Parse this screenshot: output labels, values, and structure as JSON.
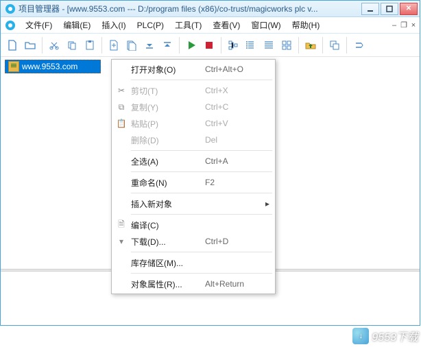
{
  "window": {
    "title": "项目管理器 - [www.9553.com --- D:/program files (x86)/co-trust/magicworks plc v..."
  },
  "menu": {
    "file": "文件(F)",
    "edit": "编辑(E)",
    "insert": "插入(I)",
    "plc": "PLC(P)",
    "tools": "工具(T)",
    "view": "查看(V)",
    "window": "窗口(W)",
    "help": "帮助(H)"
  },
  "tree": {
    "item0": "www.9553.com"
  },
  "ctx": {
    "open": {
      "label": "打开对象(O)",
      "shortcut": "Ctrl+Alt+O"
    },
    "cut": {
      "label": "剪切(T)",
      "shortcut": "Ctrl+X"
    },
    "copy": {
      "label": "复制(Y)",
      "shortcut": "Ctrl+C"
    },
    "paste": {
      "label": "粘贴(P)",
      "shortcut": "Ctrl+V"
    },
    "delete": {
      "label": "删除(D)",
      "shortcut": "Del"
    },
    "selall": {
      "label": "全选(A)",
      "shortcut": "Ctrl+A"
    },
    "rename": {
      "label": "重命名(N)",
      "shortcut": "F2"
    },
    "insnew": {
      "label": "插入新对象"
    },
    "compile": {
      "label": "编译(C)"
    },
    "download": {
      "label": "下载(D)...",
      "shortcut": "Ctrl+D"
    },
    "memory": {
      "label": "库存储区(M)..."
    },
    "props": {
      "label": "对象属性(R)...",
      "shortcut": "Alt+Return"
    }
  },
  "watermark": {
    "text": "9553下载"
  }
}
